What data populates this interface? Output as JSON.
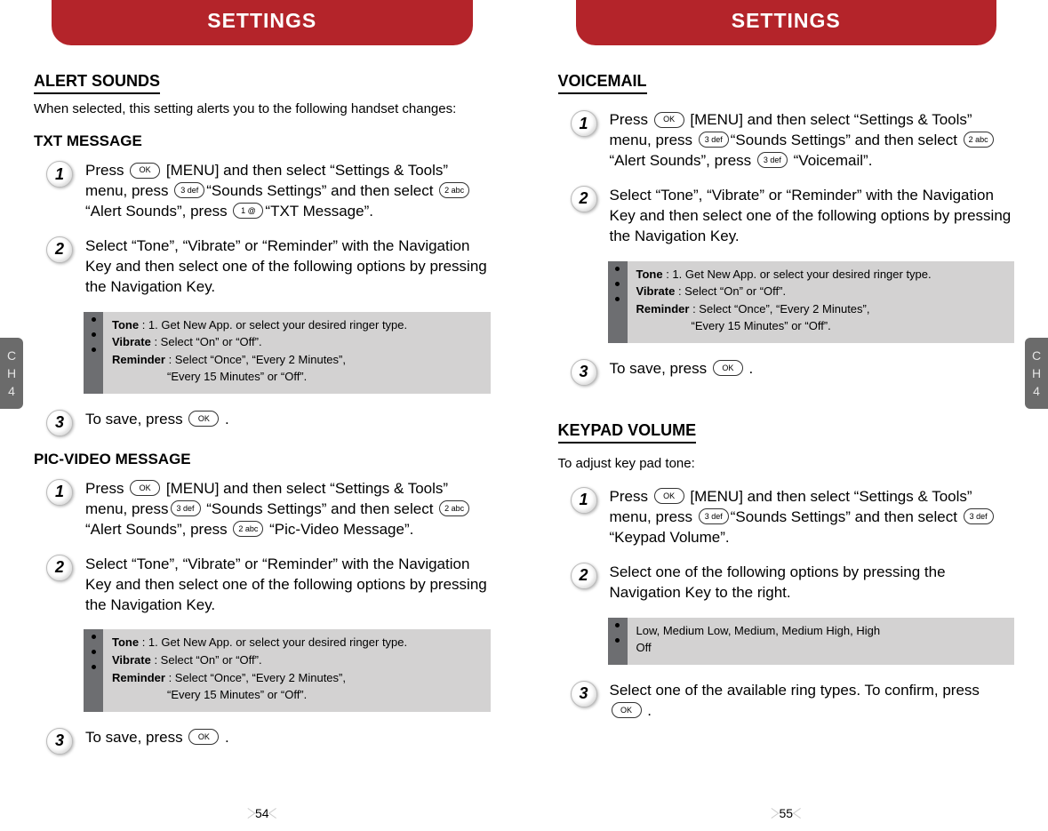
{
  "header": "SETTINGS",
  "chapter_tab": {
    "line1": "C",
    "line2": "H",
    "line3": "4"
  },
  "pages": {
    "left_num": "54",
    "right_num": "55"
  },
  "keys": {
    "ok": "OK",
    "k1": "1 @",
    "k2": "2 abc",
    "k3": "3 def"
  },
  "left": {
    "heading": "ALERT SOUNDS",
    "intro": "When selected, this setting alerts you to the following handset changes:",
    "txt": {
      "title": "TXT MESSAGE",
      "s1a": "Press ",
      "s1b": " [MENU] and then select “Settings & Tools” menu, press ",
      "s1c": "“Sounds Settings” and then select ",
      "s1d": "“Alert Sounds”, press ",
      "s1e": "“TXT Message”.",
      "s2": "Select “Tone”, “Vibrate” or “Reminder” with the Navigation Key and then select one of the following options by pressing the Navigation Key.",
      "s3a": "To save, press ",
      "s3b": " ."
    },
    "pic": {
      "title": "PIC-VIDEO MESSAGE",
      "s1a": "Press ",
      "s1b": " [MENU] and then select “Settings & Tools” menu, press",
      "s1c": " “Sounds Settings” and then select ",
      "s1d": "“Alert Sounds”, press ",
      "s1e": " “Pic-Video Message”.",
      "s2": "Select “Tone”, “Vibrate” or “Reminder” with the Navigation Key and then select one of the following options by pressing the Navigation Key.",
      "s3a": "To save, press ",
      "s3b": " ."
    }
  },
  "right": {
    "voicemail": {
      "title": "VOICEMAIL",
      "s1a": "Press ",
      "s1b": " [MENU] and then select “Settings & Tools” menu, press ",
      "s1c": "“Sounds Settings” and then select ",
      "s1d": "“Alert Sounds”, press ",
      "s1e": " “Voicemail”.",
      "s2": "Select “Tone”, “Vibrate” or “Reminder” with the Navigation Key and then select one of the following options by pressing the Navigation Key.",
      "s3a": "To save, press ",
      "s3b": " ."
    },
    "keypad": {
      "title": "KEYPAD VOLUME",
      "intro": "To adjust key pad tone:",
      "s1a": "Press ",
      "s1b": " [MENU] and then select “Settings & Tools” menu, press ",
      "s1c": "“Sounds Settings” and then select ",
      "s1d": "“Keypad Volume”.",
      "s2": "Select one of the following options by pressing the Navigation Key to the right.",
      "s3a": "Select one of the available ring types. To confirm, press ",
      "s3b": " ."
    }
  },
  "note_alert": {
    "tone_label": "Tone",
    "tone_text": " : 1. Get New App. or select your desired ringer type.",
    "vib_label": "Vibrate",
    "vib_text": " : Select “On” or “Off”.",
    "rem_label": "Reminder",
    "rem_text": " : Select “Once”, “Every 2 Minutes”,",
    "rem_text2": "“Every 15 Minutes” or “Off”."
  },
  "note_keypad": {
    "line1": "Low, Medium Low, Medium, Medium High, High",
    "line2": "Off"
  }
}
